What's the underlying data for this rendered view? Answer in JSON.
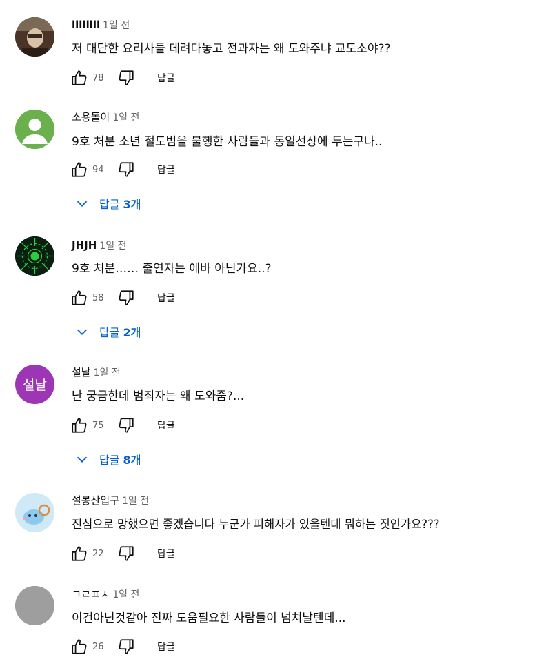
{
  "comments": [
    {
      "author": "llllllll",
      "time": "1일 전",
      "text": "저 대단한 요리사들 데려다놓고 전과자는 왜 도와주냐 교도소야??",
      "likes": "78",
      "reply_label": "답글",
      "avatar": {
        "type": "photo",
        "color": "#6b5040"
      }
    },
    {
      "author": "소용돌이",
      "time": "1일 전",
      "text": "9호 처분 소년 절도범을 불행한 사람들과 동일선상에 두는구나..",
      "likes": "94",
      "reply_label": "답글",
      "avatar": {
        "type": "default-person",
        "color": "#6ab04c"
      },
      "replies": {
        "label": "답글",
        "count": "3개"
      }
    },
    {
      "author": "JHJH",
      "time": "1일 전",
      "text": "9호 처분…… 출연자는 에바 아닌가요..?",
      "likes": "58",
      "reply_label": "답글",
      "avatar": {
        "type": "circuit",
        "color": "#0f2a18"
      },
      "replies": {
        "label": "답글",
        "count": "2개"
      }
    },
    {
      "author": "설날",
      "time": "1일 전",
      "text": "난 궁금한데 범죄자는 왜 도와줌?...",
      "likes": "75",
      "reply_label": "답글",
      "avatar": {
        "type": "initial",
        "initial": "설날",
        "color": "#9c36b5"
      },
      "replies": {
        "label": "답글",
        "count": "8개"
      }
    },
    {
      "author": "설봉산입구",
      "time": "1일 전",
      "text": "진심으로 망했으면 좋겠습니다 누군가 피해자가 있을텐데 뭐하는 짓인가요???",
      "likes": "22",
      "reply_label": "답글",
      "avatar": {
        "type": "cartoon",
        "color": "#bfe3f5"
      }
    },
    {
      "author": "ㄱㄹㅍㅅ",
      "time": "1일 전",
      "text": "이건아닌것같아 진짜 도움필요한 사람들이 넘쳐날텐데...",
      "likes": "26",
      "reply_label": "답글",
      "avatar": {
        "type": "plain",
        "color": "#9e9e9e"
      }
    }
  ],
  "icons": {
    "like": "thumbs-up-icon",
    "dislike": "thumbs-down-icon",
    "expand": "chevron-down-icon"
  },
  "colors": {
    "link": "#065fd4",
    "muted": "#606060"
  }
}
